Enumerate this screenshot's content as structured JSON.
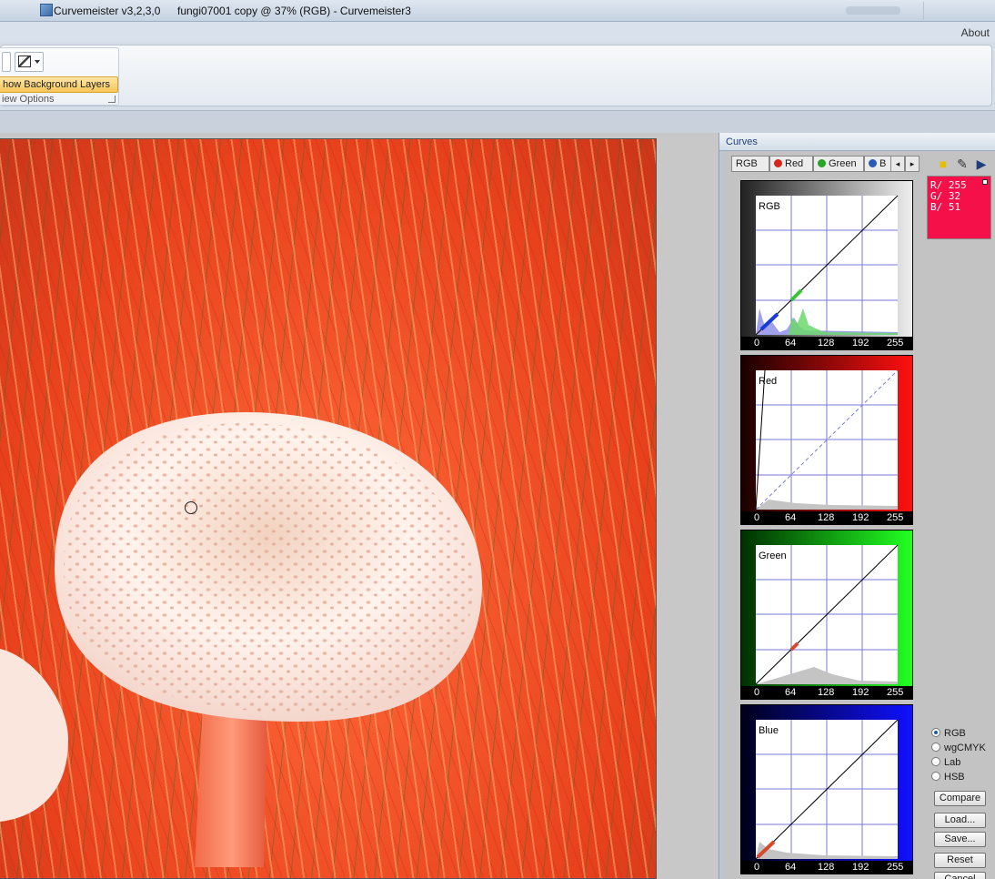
{
  "window": {
    "app_title": "Curvemeister v3,2,3,0",
    "doc_title": "fungi07001 copy @ 37% (RGB) - Curvemeister3"
  },
  "menu": {
    "about": "About"
  },
  "ribbon": {
    "show_bg_layers": "how Background Layers",
    "group_label": "iew Options"
  },
  "curves": {
    "panel_title": "Curves",
    "tabs": [
      {
        "label": "RGB",
        "dot": ""
      },
      {
        "label": "Red",
        "dot": "#d8241c"
      },
      {
        "label": "Green",
        "dot": "#27a524"
      },
      {
        "label": "B",
        "dot": "#2a5ab8"
      }
    ],
    "scroll_left": "◂",
    "scroll_right": "▸",
    "icons": {
      "folder": "folder-icon",
      "wrench": "wrench-icon",
      "play": "play-icon"
    },
    "channels": [
      {
        "label": "RGB"
      },
      {
        "label": "Red"
      },
      {
        "label": "Green"
      },
      {
        "label": "Blue"
      }
    ],
    "ticks": [
      "0",
      "64",
      "128",
      "192",
      "255"
    ],
    "swatch": {
      "r": "R/ 255",
      "g": "G/  32",
      "b": "B/  51",
      "color": "#f5104a"
    },
    "modes": [
      {
        "label": "RGB",
        "selected": true
      },
      {
        "label": "wgCMYK",
        "selected": false
      },
      {
        "label": "Lab",
        "selected": false
      },
      {
        "label": "HSB",
        "selected": false
      }
    ],
    "buttons": [
      "Compare",
      "Load...",
      "Save...",
      "Reset",
      "Cancel"
    ]
  }
}
